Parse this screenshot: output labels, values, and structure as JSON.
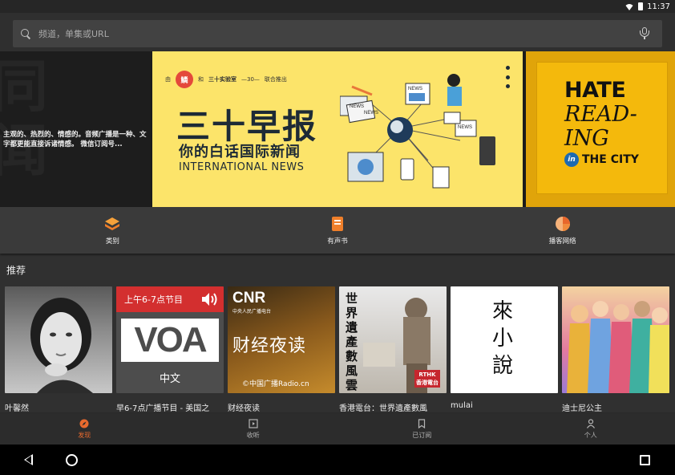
{
  "status_bar": {
    "time": "11:37",
    "icons": [
      "wifi-icon",
      "battery-icon"
    ]
  },
  "search": {
    "placeholder": "频道，单集或URL",
    "value": "",
    "icons": [
      "search-icon",
      "mic-icon"
    ]
  },
  "banner": {
    "left_slide": {
      "text": "主观的、热烈的、情感的。音频广播是一种、文字都更能直接诉诸情感。 微信订阅号..."
    },
    "main_slide": {
      "partners": {
        "prefix": "由",
        "seal": "鳞",
        "joiner": "和",
        "lab": "三十实验室",
        "tag": "—30—",
        "suffix": "联合推出"
      },
      "title": "三十早报",
      "subtitle": "你的白话国际新闻",
      "english": "INTERNATIONAL NEWS",
      "badges": [
        "NEWS",
        "NEWS",
        "NEWS",
        "NEWS"
      ]
    },
    "right_slide": {
      "line1": "HATE",
      "line2": "READ-",
      "line3": "ING",
      "badge": "in",
      "line4": "THE CITY"
    }
  },
  "categories": [
    {
      "label": "类别",
      "icon": "layers-icon"
    },
    {
      "label": "有声书",
      "icon": "audiobook-icon"
    },
    {
      "label": "播客网络",
      "icon": "podcast-network-icon"
    }
  ],
  "section": {
    "title": "推荐"
  },
  "cards": [
    {
      "title": "叶馨然"
    },
    {
      "title": "早6-7点广播节目 - 美国之",
      "art": {
        "top": "上午6-7点节目",
        "logo": "VOA",
        "bottom": "中文"
      }
    },
    {
      "title": "财经夜读",
      "art": {
        "brand": "CNR",
        "brand_sub": "中央人民广播电台",
        "name": "财经夜读",
        "footer": "©中国广播Radio.cn"
      }
    },
    {
      "title": "香港電台：世界遺產數風",
      "art": {
        "vertical": "世界遺產數風雲",
        "badge": "RTHK",
        "badge_sub": "香港電台"
      }
    },
    {
      "title": "mulai",
      "art": {
        "vertical": "來小說"
      }
    },
    {
      "title": "迪士尼公主"
    }
  ],
  "bottom_nav": [
    {
      "label": "发现",
      "icon": "discover-icon",
      "active": true
    },
    {
      "label": "收听",
      "icon": "listen-icon",
      "active": false
    },
    {
      "label": "已订阅",
      "icon": "subscribed-icon",
      "active": false
    },
    {
      "label": "个人",
      "icon": "profile-icon",
      "active": false
    }
  ],
  "colors": {
    "accent": "#e86a2e",
    "banner_yellow": "#fce46a",
    "book_yellow": "#f4b90c",
    "background": "#303030"
  }
}
